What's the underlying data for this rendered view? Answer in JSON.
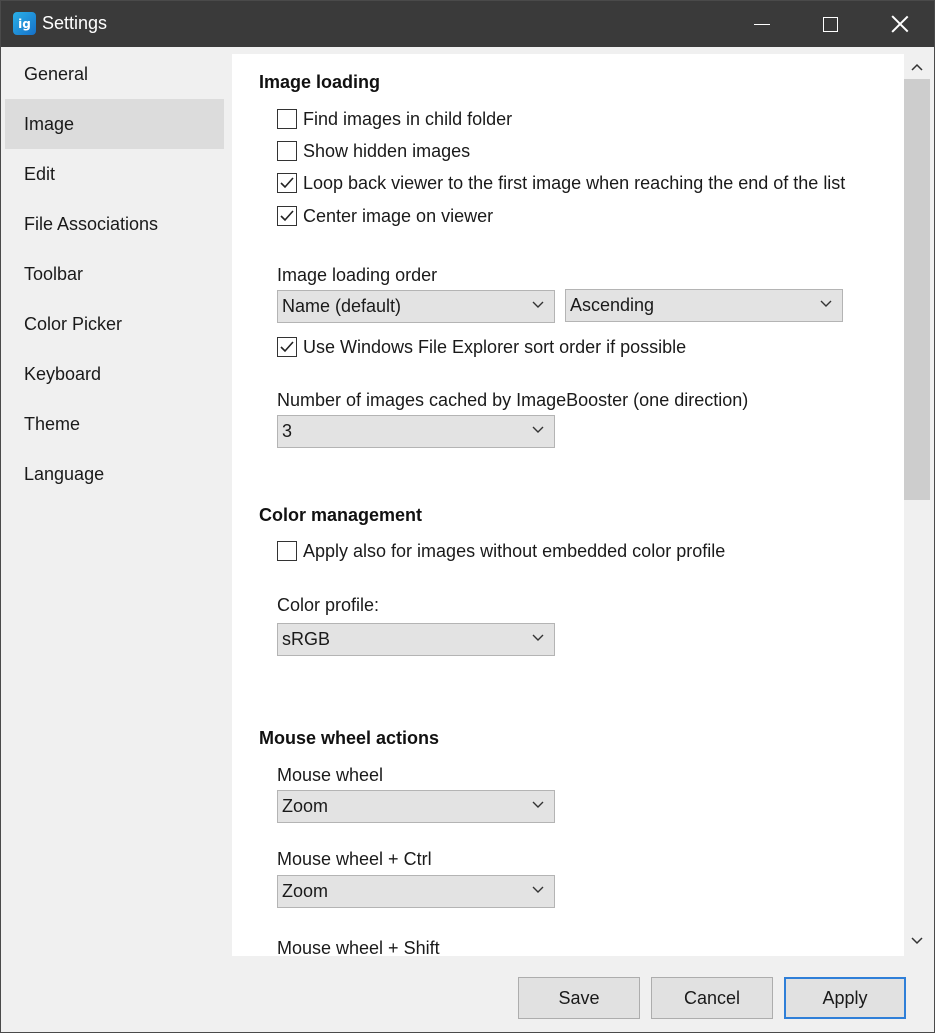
{
  "window": {
    "title": "Settings",
    "app_icon_text": "ig"
  },
  "sidebar": {
    "items": [
      {
        "label": "General"
      },
      {
        "label": "Image",
        "selected": true
      },
      {
        "label": "Edit"
      },
      {
        "label": "File Associations"
      },
      {
        "label": "Toolbar"
      },
      {
        "label": "Color Picker"
      },
      {
        "label": "Keyboard"
      },
      {
        "label": "Theme"
      },
      {
        "label": "Language"
      }
    ]
  },
  "image_loading": {
    "title": "Image loading",
    "checks": [
      {
        "label": "Find images in child folder",
        "checked": false
      },
      {
        "label": "Show hidden images",
        "checked": false
      },
      {
        "label": "Loop back viewer to the first image when reaching the end of the list",
        "checked": true
      },
      {
        "label": "Center image on viewer",
        "checked": true
      }
    ],
    "order_label": "Image loading order",
    "order_value": "Name (default)",
    "direction_value": "Ascending",
    "explorer_sort": {
      "label": "Use Windows File Explorer sort order if possible",
      "checked": true
    },
    "cache_label": "Number of images cached by ImageBooster (one direction)",
    "cache_value": "3"
  },
  "color_management": {
    "title": "Color management",
    "apply_check": {
      "label": "Apply also for images without embedded color profile",
      "checked": false
    },
    "profile_label": "Color profile:",
    "profile_value": "sRGB"
  },
  "mouse_wheel": {
    "title": "Mouse wheel actions",
    "wheel_label": "Mouse wheel",
    "wheel_value": "Zoom",
    "ctrl_label": "Mouse wheel + Ctrl",
    "ctrl_value": "Zoom",
    "shift_label": "Mouse wheel + Shift"
  },
  "buttons": {
    "save": "Save",
    "cancel": "Cancel",
    "apply": "Apply"
  },
  "colors": {
    "titlebar": "#3a3a3a",
    "accent": "#2f7fd8",
    "selected_nav": "#dcdcdc"
  }
}
